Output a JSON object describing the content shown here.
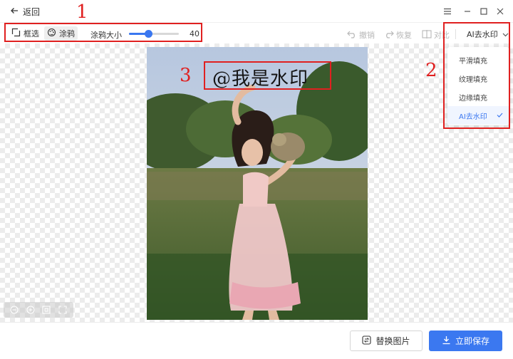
{
  "header": {
    "back_label": "返回"
  },
  "toolbar": {
    "select_tool_label": "框选",
    "brush_tool_label": "涂鸦",
    "brush_size_label": "涂鸦大小",
    "brush_size_value": "40",
    "brush_size_fraction": 0.38,
    "undo_label": "撤销",
    "redo_label": "恢复",
    "compare_label": "对比",
    "mode_selected": "AI去水印"
  },
  "mode_menu": {
    "items": [
      {
        "label": "平滑填充",
        "selected": false
      },
      {
        "label": "纹理填充",
        "selected": false
      },
      {
        "label": "边缘填充",
        "selected": false
      },
      {
        "label": "AI去水印",
        "selected": true
      }
    ]
  },
  "canvas": {
    "watermark_text": "@我是水印"
  },
  "annotations": {
    "marker_1": "1",
    "marker_2": "2",
    "marker_3": "3"
  },
  "footer": {
    "replace_label": "替换图片",
    "save_label": "立即保存"
  },
  "colors": {
    "accent": "#3b78f0",
    "annotation": "#e02020"
  },
  "icons": [
    "arrow-left-icon",
    "menu-icon",
    "minimize-icon",
    "maximize-icon",
    "close-icon",
    "select-rect-icon",
    "brush-icon",
    "undo-icon",
    "redo-icon",
    "compare-icon",
    "chevron-down-icon",
    "check-icon",
    "zoom-out-icon",
    "zoom-in-icon",
    "fit-icon",
    "fullscreen-icon",
    "replace-icon",
    "download-icon"
  ]
}
